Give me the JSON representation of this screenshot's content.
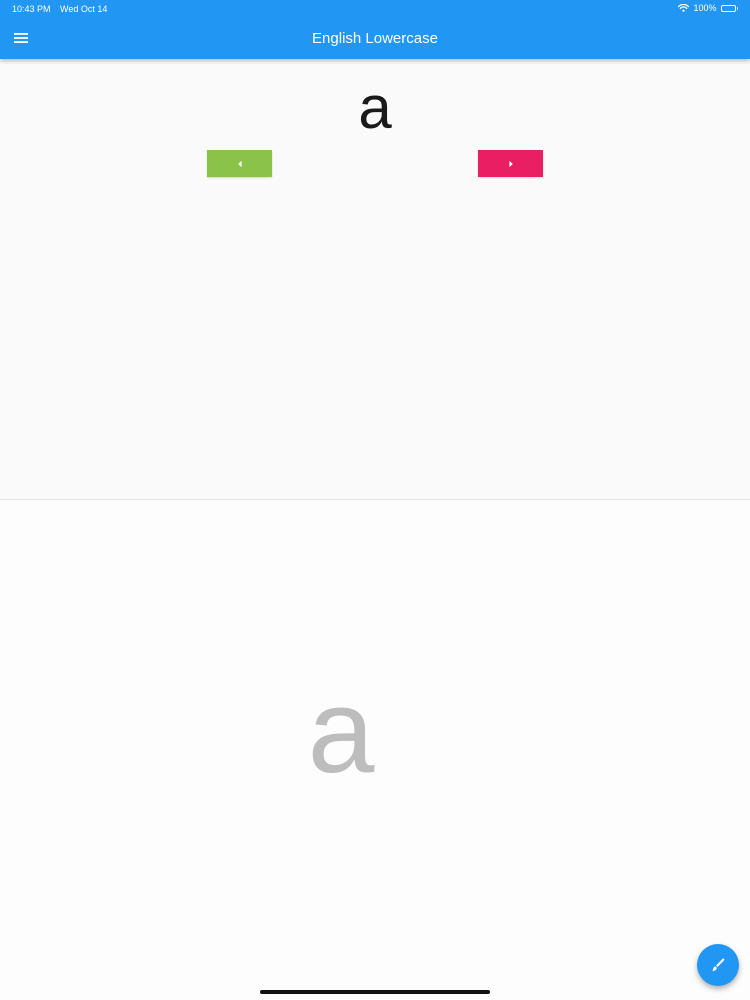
{
  "status_bar": {
    "time": "10:43 PM",
    "date": "Wed Oct 14",
    "battery": "100%"
  },
  "app_bar": {
    "title": "English Lowercase",
    "menu_icon": "hamburger-menu-icon",
    "color": "#2196f3"
  },
  "flashcard": {
    "letter": "a",
    "prev_icon": "caret-left-icon",
    "next_icon": "caret-right-icon",
    "prev_color": "#8bc34a",
    "next_color": "#e91e63"
  },
  "tracing": {
    "letter": "a",
    "letter_color": "#bdbdbd"
  },
  "fab": {
    "icon": "brush-icon",
    "color": "#2196f3"
  }
}
